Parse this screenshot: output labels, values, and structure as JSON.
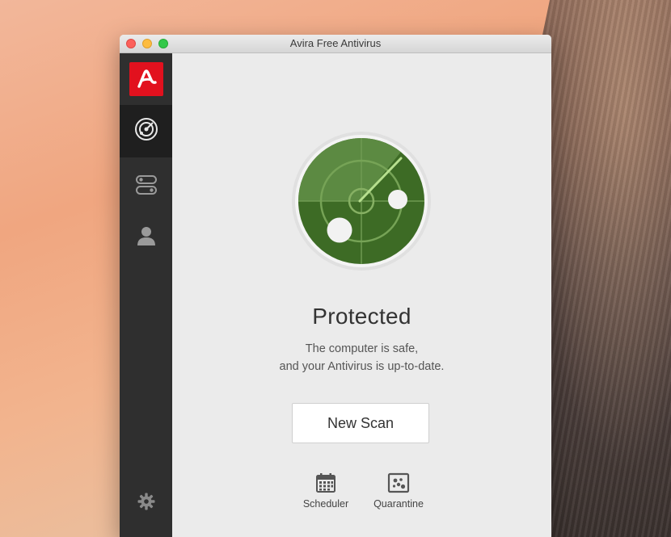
{
  "window": {
    "title": "Avira Free Antivirus"
  },
  "sidebar": {
    "items": [
      {
        "name": "scan",
        "icon": "radar-icon",
        "active": true
      },
      {
        "name": "modules",
        "icon": "toggles-icon",
        "active": false
      },
      {
        "name": "account",
        "icon": "user-icon",
        "active": false
      }
    ],
    "settings_icon": "gear-icon",
    "logo_icon": "avira-logo-icon"
  },
  "status": {
    "title": "Protected",
    "line1": "The computer is safe,",
    "line2": "and your Antivirus is up-to-date."
  },
  "actions": {
    "new_scan_label": "New Scan"
  },
  "tools": {
    "scheduler_label": "Scheduler",
    "quarantine_label": "Quarantine"
  },
  "colors": {
    "brand_red": "#e2111e",
    "radar_green": "#3f6f2a",
    "sidebar_bg": "#2f2f2f"
  }
}
